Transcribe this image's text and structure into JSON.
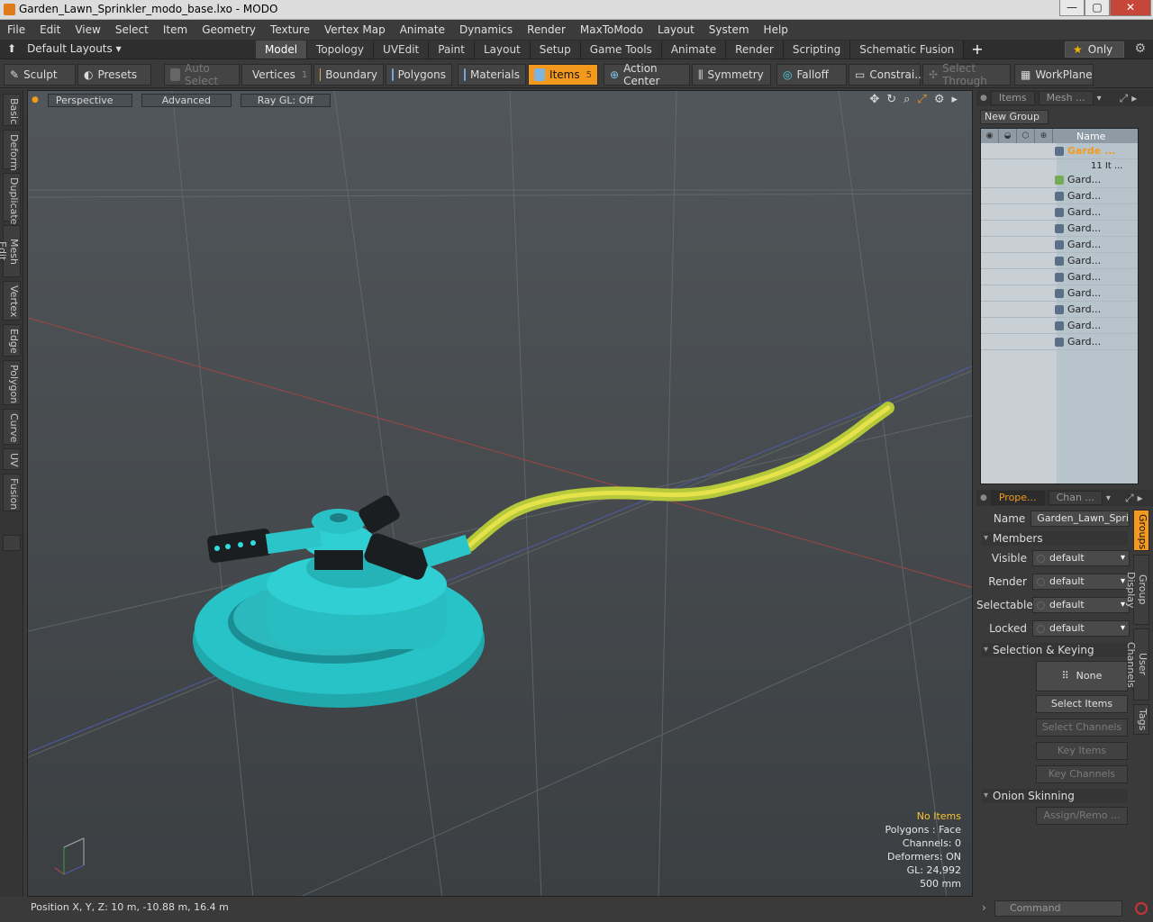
{
  "window": {
    "title": "Garden_Lawn_Sprinkler_modo_base.lxo - MODO",
    "btn_min": "—",
    "btn_max": "▢",
    "btn_close": "✕"
  },
  "menu": [
    "File",
    "Edit",
    "View",
    "Select",
    "Item",
    "Geometry",
    "Texture",
    "Vertex Map",
    "Animate",
    "Dynamics",
    "Render",
    "MaxToModo",
    "Layout",
    "System",
    "Help"
  ],
  "layouts": {
    "label": "Default Layouts"
  },
  "tabs": [
    "Model",
    "Topology",
    "UVEdit",
    "Paint",
    "Layout",
    "Setup",
    "Game Tools",
    "Animate",
    "Render",
    "Scripting",
    "Schematic Fusion"
  ],
  "active_tab": "Model",
  "only_label": "Only",
  "toolbar": {
    "sculpt": "Sculpt",
    "presets": "Presets",
    "auto_select": "Auto Select",
    "vertices": "Vertices",
    "vertices_count": "1",
    "boundary": "Boundary",
    "polygons": "Polygons",
    "materials": "Materials",
    "items": "Items",
    "items_count": "5",
    "action_center": "Action Center",
    "symmetry": "Symmetry",
    "falloff": "Falloff",
    "constraints": "Constrai...",
    "select_through": "Select Through",
    "workplane": "WorkPlane"
  },
  "left_tabs": [
    "Basic",
    "Deform",
    "Duplicate",
    "Mesh Edit",
    "Vertex",
    "Edge",
    "Polygon",
    "Curve",
    "UV",
    "Fusion"
  ],
  "viewport": {
    "perspective": "Perspective",
    "advanced": "Advanced",
    "raygl": "Ray GL: Off"
  },
  "hud": {
    "items": "No Items",
    "polygons": "Polygons : Face",
    "channels": "Channels: 0",
    "deformers": "Deformers: ON",
    "gl": "GL: 24,992",
    "size": "500 mm"
  },
  "status": {
    "position": "Position X, Y, Z:   10 m, -10.88 m, 16.4 m"
  },
  "items_panel": {
    "tab_items": "Items",
    "tab_mesh": "Mesh ...",
    "new_group": "New Group",
    "name_header": "Name",
    "root_label": "Garde ...",
    "root_sub": "11 It ...",
    "children": [
      "Gard...",
      "Gard...",
      "Gard...",
      "Gard...",
      "Gard...",
      "Gard...",
      "Gard...",
      "Gard...",
      "Gard...",
      "Gard...",
      "Gard..."
    ]
  },
  "props": {
    "tab_props": "Prope...",
    "tab_chan": "Chan ...",
    "name_label": "Name",
    "name_value": "Garden_Lawn_Spri",
    "members": "Members",
    "visible": "Visible",
    "render": "Render",
    "selectable": "Selectable",
    "locked": "Locked",
    "default": "default",
    "sel_keying": "Selection & Keying",
    "none": "None",
    "select_items": "Select Items",
    "select_channels": "Select Channels",
    "key_items": "Key Items",
    "key_channels": "Key Channels",
    "onion": "Onion Skinning",
    "assign": "Assign/Remo ..."
  },
  "right_vtabs": [
    "Groups",
    "Group Display",
    "User Channels",
    "Tags"
  ],
  "command": {
    "placeholder": "Command"
  }
}
